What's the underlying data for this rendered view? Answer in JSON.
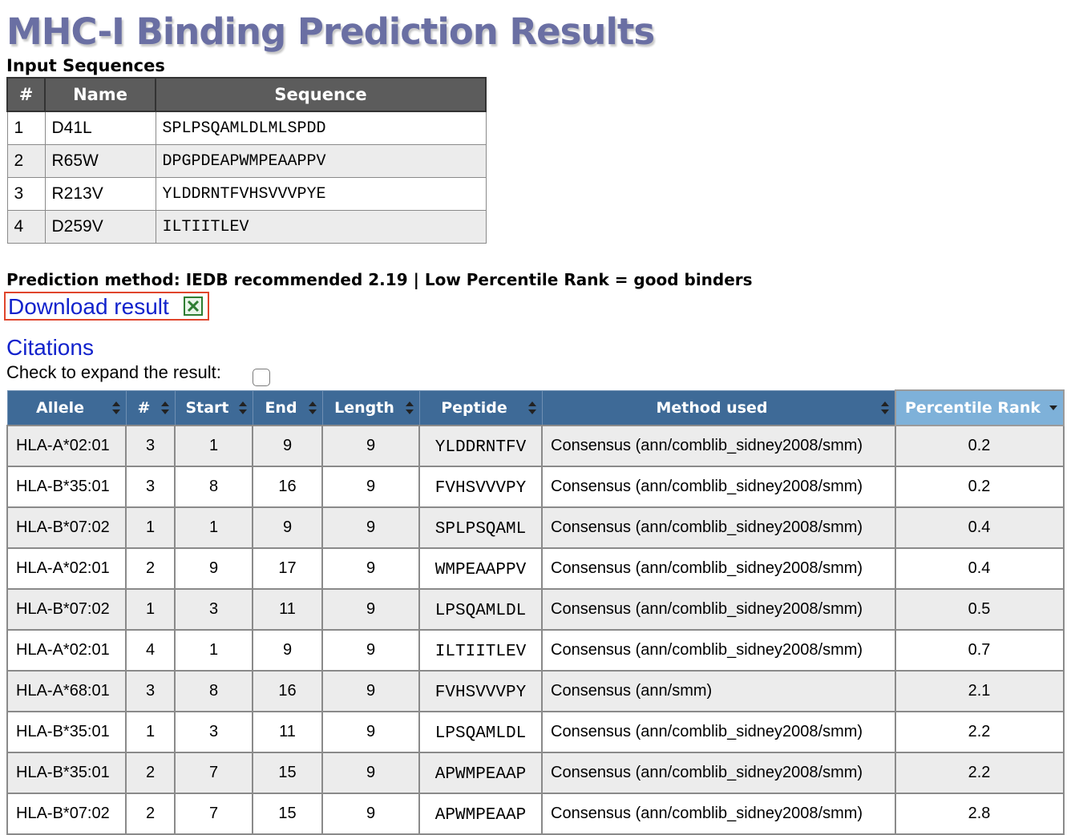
{
  "page_title": "MHC-I Binding Prediction Results",
  "input_section": {
    "heading": "Input Sequences",
    "columns": [
      "#",
      "Name",
      "Sequence"
    ],
    "rows": [
      {
        "num": "1",
        "name": "D41L",
        "sequence": "SPLPSQAMLDLMLSPDD"
      },
      {
        "num": "2",
        "name": "R65W",
        "sequence": "DPGPDEAPWMPEAAPPV"
      },
      {
        "num": "3",
        "name": "R213V",
        "sequence": "YLDDRNTFVHSVVVPYE"
      },
      {
        "num": "4",
        "name": "D259V",
        "sequence": "ILTIITLEV"
      }
    ]
  },
  "method_line": "Prediction method: IEDB recommended 2.19 | Low Percentile Rank = good binders",
  "download": {
    "label": "Download result",
    "icon": "excel-icon",
    "highlight_color": "#e0452c"
  },
  "citations_label": "Citations",
  "expand_label": "Check to expand the result:",
  "results": {
    "columns": [
      "Allele",
      "#",
      "Start",
      "End",
      "Length",
      "Peptide",
      "Method used",
      "Percentile Rank"
    ],
    "sorted_column": "Percentile Rank",
    "rows": [
      {
        "allele": "HLA-A*02:01",
        "num": "3",
        "start": "1",
        "end": "9",
        "length": "9",
        "peptide": "YLDDRNTFV",
        "method": "Consensus (ann/comblib_sidney2008/smm)",
        "rank": "0.2"
      },
      {
        "allele": "HLA-B*35:01",
        "num": "3",
        "start": "8",
        "end": "16",
        "length": "9",
        "peptide": "FVHSVVVPY",
        "method": "Consensus (ann/comblib_sidney2008/smm)",
        "rank": "0.2"
      },
      {
        "allele": "HLA-B*07:02",
        "num": "1",
        "start": "1",
        "end": "9",
        "length": "9",
        "peptide": "SPLPSQAML",
        "method": "Consensus (ann/comblib_sidney2008/smm)",
        "rank": "0.4"
      },
      {
        "allele": "HLA-A*02:01",
        "num": "2",
        "start": "9",
        "end": "17",
        "length": "9",
        "peptide": "WMPEAAPPV",
        "method": "Consensus (ann/comblib_sidney2008/smm)",
        "rank": "0.4"
      },
      {
        "allele": "HLA-B*07:02",
        "num": "1",
        "start": "3",
        "end": "11",
        "length": "9",
        "peptide": "LPSQAMLDL",
        "method": "Consensus (ann/comblib_sidney2008/smm)",
        "rank": "0.5"
      },
      {
        "allele": "HLA-A*02:01",
        "num": "4",
        "start": "1",
        "end": "9",
        "length": "9",
        "peptide": "ILTIITLEV",
        "method": "Consensus (ann/comblib_sidney2008/smm)",
        "rank": "0.7"
      },
      {
        "allele": "HLA-A*68:01",
        "num": "3",
        "start": "8",
        "end": "16",
        "length": "9",
        "peptide": "FVHSVVVPY",
        "method": "Consensus (ann/smm)",
        "rank": "2.1"
      },
      {
        "allele": "HLA-B*35:01",
        "num": "1",
        "start": "3",
        "end": "11",
        "length": "9",
        "peptide": "LPSQAMLDL",
        "method": "Consensus (ann/comblib_sidney2008/smm)",
        "rank": "2.2"
      },
      {
        "allele": "HLA-B*35:01",
        "num": "2",
        "start": "7",
        "end": "15",
        "length": "9",
        "peptide": "APWMPEAAP",
        "method": "Consensus (ann/comblib_sidney2008/smm)",
        "rank": "2.2"
      },
      {
        "allele": "HLA-B*07:02",
        "num": "2",
        "start": "7",
        "end": "15",
        "length": "9",
        "peptide": "APWMPEAAP",
        "method": "Consensus (ann/comblib_sidney2008/smm)",
        "rank": "2.8"
      }
    ]
  },
  "colors": {
    "title": "#6a6fa3",
    "header_bg": "#3e6a97",
    "sorted_header_bg": "#7eb1d9",
    "link": "#1122cc"
  }
}
